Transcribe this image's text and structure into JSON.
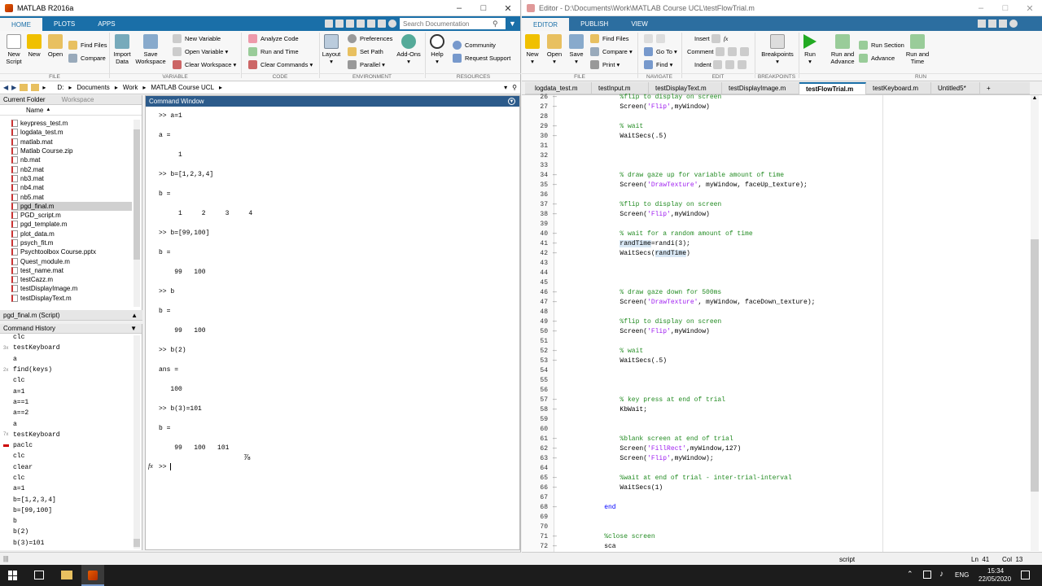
{
  "matlab": {
    "title": "MATLAB R2016a",
    "tabs": [
      "HOME",
      "PLOTS",
      "APPS"
    ],
    "search_placeholder": "Search Documentation",
    "ribbon": {
      "new_script": "New\nScript",
      "new": "New",
      "open": "Open",
      "find_files": "Find Files",
      "compare": "Compare",
      "import_data": "Import\nData",
      "save_workspace": "Save\nWorkspace",
      "new_variable": "New Variable",
      "open_variable": "Open Variable",
      "clear_workspace": "Clear Workspace",
      "analyze_code": "Analyze Code",
      "run_and_time": "Run and Time",
      "clear_commands": "Clear Commands",
      "layout": "Layout",
      "preferences": "Preferences",
      "set_path": "Set Path",
      "parallel": "Parallel",
      "add_ons": "Add-Ons",
      "help": "Help",
      "community": "Community",
      "request_support": "Request Support",
      "groups": [
        "FILE",
        "VARIABLE",
        "CODE",
        "ENVIRONMENT",
        "RESOURCES"
      ]
    },
    "address": [
      "D:",
      "Documents",
      "Work",
      "MATLAB Course UCL"
    ],
    "current_folder_title": "Current Folder",
    "workspace_tab": "Workspace",
    "name_header": "Name",
    "files": [
      "keypress_test.m",
      "logdata_test.m",
      "matlab.mat",
      "Matlab Course.zip",
      "nb.mat",
      "nb2.mat",
      "nb3.mat",
      "nb4.mat",
      "nb5.mat",
      "pgd_final.m",
      "PGD_script.m",
      "pgd_template.m",
      "plot_data.m",
      "psych_fit.m",
      "Psychtoolbox Course.pptx",
      "Quest_module.m",
      "test_name.mat",
      "testCazz.m",
      "testDisplayImage.m",
      "testDisplayText.m"
    ],
    "selected_file": "pgd_final.m",
    "details_title": "pgd_final.m (Script)",
    "history_title": "Command History",
    "history": [
      {
        "badge": "",
        "text": "clc"
      },
      {
        "badge": "3x",
        "text": "testKeyboard"
      },
      {
        "badge": "",
        "text": "a"
      },
      {
        "badge": "2x",
        "text": "find(keys)"
      },
      {
        "badge": "",
        "text": "clc"
      },
      {
        "badge": "",
        "text": "a=1"
      },
      {
        "badge": "",
        "text": "a==1"
      },
      {
        "badge": "",
        "text": "a==2"
      },
      {
        "badge": "",
        "text": "a"
      },
      {
        "badge": "7x",
        "text": "testKeyboard"
      },
      {
        "badge": "",
        "text": "paclc"
      },
      {
        "badge": "",
        "text": "clc"
      },
      {
        "badge": "",
        "text": "clear"
      },
      {
        "badge": "",
        "text": "clc"
      },
      {
        "badge": "",
        "text": "a=1"
      },
      {
        "badge": "",
        "text": "b=[1,2,3,4]"
      },
      {
        "badge": "",
        "text": "b=[99,100]"
      },
      {
        "badge": "",
        "text": "b"
      },
      {
        "badge": "",
        "text": "b(2)"
      },
      {
        "badge": "",
        "text": "b(3)=101"
      }
    ],
    "command_window_title": "Command Window",
    "command_lines": [
      ">> a=1",
      "a =",
      "     1",
      ">> b=[1,2,3,4]",
      "b =",
      "     1     2     3     4",
      ">> b=[99,100]",
      "b =",
      "    99   100",
      ">> b",
      "b =",
      "    99   100",
      ">> b(2)",
      "ans =",
      "   100",
      ">> b(3)=101",
      "b =",
      "    99   100   101"
    ],
    "prompt": ">> ",
    "fx": "fx"
  },
  "editor": {
    "title": "Editor - D:\\Documents\\Work\\MATLAB Course UCL\\testFlowTrial.m",
    "tabs": [
      "EDITOR",
      "PUBLISH",
      "VIEW"
    ],
    "ribbon": {
      "new": "New",
      "open": "Open",
      "save": "Save",
      "find_files": "Find Files",
      "compare": "Compare",
      "print": "Print",
      "go_to": "Go To",
      "find": "Find",
      "insert": "Insert",
      "comment": "Comment",
      "indent": "Indent",
      "breakpoints": "Breakpoints",
      "run": "Run",
      "run_and_advance": "Run and\nAdvance",
      "run_section": "Run Section",
      "advance": "Advance",
      "run_and_time": "Run and\nTime",
      "groups": [
        "FILE",
        "NAVIGATE",
        "EDIT",
        "BREAKPOINTS",
        "RUN"
      ]
    },
    "file_tabs": [
      "logdata_test.m",
      "testInput.m",
      "testDisplayText.m",
      "testDisplayImage.m",
      "testFlowTrial.m",
      "testKeyboard.m",
      "Untitled5*"
    ],
    "active_tab": "testFlowTrial.m",
    "lines": [
      {
        "n": "26",
        "t": "        %flip to display on screen",
        "c": "cm"
      },
      {
        "n": "27",
        "t": "        Screen('Flip',myWindow)",
        "c": ""
      },
      {
        "n": "28",
        "t": "",
        "c": ""
      },
      {
        "n": "29",
        "t": "        % wait",
        "c": "cm"
      },
      {
        "n": "30",
        "t": "        WaitSecs(.5)",
        "c": ""
      },
      {
        "n": "31",
        "t": "",
        "c": ""
      },
      {
        "n": "32",
        "t": "",
        "c": ""
      },
      {
        "n": "33",
        "t": "",
        "c": ""
      },
      {
        "n": "34",
        "t": "        % draw gaze up for variable amount of time",
        "c": "cm"
      },
      {
        "n": "35",
        "t": "        Screen('DrawTexture', myWindow, faceUp_texture);",
        "c": ""
      },
      {
        "n": "36",
        "t": "",
        "c": ""
      },
      {
        "n": "37",
        "t": "        %flip to display on screen",
        "c": "cm"
      },
      {
        "n": "38",
        "t": "        Screen('Flip',myWindow)",
        "c": ""
      },
      {
        "n": "39",
        "t": "",
        "c": ""
      },
      {
        "n": "40",
        "t": "        % wait for a random amount of time",
        "c": "cm"
      },
      {
        "n": "41",
        "t": "        randTime=randi(3);",
        "c": ""
      },
      {
        "n": "42",
        "t": "        WaitSecs(randTime)",
        "c": ""
      },
      {
        "n": "43",
        "t": "",
        "c": ""
      },
      {
        "n": "44",
        "t": "",
        "c": ""
      },
      {
        "n": "45",
        "t": "",
        "c": ""
      },
      {
        "n": "46",
        "t": "        % draw gaze down for 500ms",
        "c": "cm"
      },
      {
        "n": "47",
        "t": "        Screen('DrawTexture', myWindow, faceDown_texture);",
        "c": ""
      },
      {
        "n": "48",
        "t": "",
        "c": ""
      },
      {
        "n": "49",
        "t": "        %flip to display on screen",
        "c": "cm"
      },
      {
        "n": "50",
        "t": "        Screen('Flip',myWindow)",
        "c": ""
      },
      {
        "n": "51",
        "t": "",
        "c": ""
      },
      {
        "n": "52",
        "t": "        % wait",
        "c": "cm"
      },
      {
        "n": "53",
        "t": "        WaitSecs(.5)",
        "c": ""
      },
      {
        "n": "54",
        "t": "",
        "c": ""
      },
      {
        "n": "55",
        "t": "",
        "c": ""
      },
      {
        "n": "56",
        "t": "",
        "c": ""
      },
      {
        "n": "57",
        "t": "        % key press at end of trial",
        "c": "cm"
      },
      {
        "n": "58",
        "t": "        KbWait;",
        "c": ""
      },
      {
        "n": "59",
        "t": "",
        "c": ""
      },
      {
        "n": "60",
        "t": "",
        "c": ""
      },
      {
        "n": "61",
        "t": "        %blank screen at end of trial",
        "c": "cm"
      },
      {
        "n": "62",
        "t": "        Screen('FillRect',myWindow,127)",
        "c": ""
      },
      {
        "n": "63",
        "t": "        Screen('Flip',myWindow);",
        "c": ""
      },
      {
        "n": "64",
        "t": "",
        "c": ""
      },
      {
        "n": "65",
        "t": "        %wait at end of trial - inter-trial-interval",
        "c": "cm"
      },
      {
        "n": "66",
        "t": "        WaitSecs(1)",
        "c": ""
      },
      {
        "n": "67",
        "t": "",
        "c": ""
      },
      {
        "n": "68",
        "t": "    end",
        "c": "kw"
      },
      {
        "n": "69",
        "t": "",
        "c": ""
      },
      {
        "n": "70",
        "t": "",
        "c": ""
      },
      {
        "n": "71",
        "t": "    %close screen",
        "c": "cm"
      },
      {
        "n": "72",
        "t": "    sca",
        "c": ""
      }
    ],
    "status": {
      "mode": "script",
      "ln": "Ln  41",
      "col": "Col  13"
    }
  },
  "taskbar": {
    "time": "15:34",
    "date": "22/05/2020",
    "lang": "ENG"
  },
  "colors": {
    "matlab_blue": "#1a6fa8",
    "comment": "#228b22",
    "string": "#a020f0",
    "keyword": "#0000ff"
  }
}
